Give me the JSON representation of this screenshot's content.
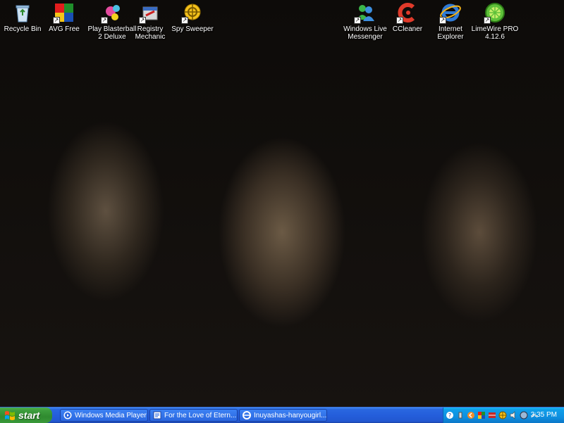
{
  "desktop": {
    "icons": [
      {
        "label": "Recycle Bin",
        "icon": "recycle-bin-icon"
      },
      {
        "label": "AVG Free",
        "icon": "avg-icon"
      },
      {
        "label": "Play Blasterball\n2 Deluxe",
        "icon": "blasterball-icon"
      },
      {
        "label": "Registry\nMechanic",
        "icon": "registry-mechanic-icon"
      },
      {
        "label": "Spy Sweeper",
        "icon": "spy-sweeper-icon"
      },
      {
        "label": "Windows Live\nMessenger",
        "icon": "messenger-icon"
      },
      {
        "label": "CCleaner",
        "icon": "ccleaner-icon"
      },
      {
        "label": "Internet\nExplorer",
        "icon": "internet-explorer-icon"
      },
      {
        "label": "LimeWire PRO\n4.12.6",
        "icon": "limewire-icon"
      }
    ]
  },
  "taskbar": {
    "start_label": "start",
    "tasks": [
      {
        "label": "Windows Media Player",
        "icon": "media-player-icon"
      },
      {
        "label": "For the Love of Etern...",
        "icon": "document-icon"
      },
      {
        "label": "Inuyashas-hanyougirl...",
        "icon": "browser-icon"
      }
    ],
    "tray": {
      "icons": [
        "help-icon",
        "network-icon",
        "back-icon",
        "avg-tray-icon",
        "firewall-icon",
        "globe-icon",
        "speaker-icon",
        "spyware-icon",
        "connection-icon"
      ],
      "clock": "3:35 PM"
    }
  },
  "colors": {
    "taskbar": "#245edb",
    "start": "#3c9c3c",
    "tray": "#0e90e0"
  }
}
